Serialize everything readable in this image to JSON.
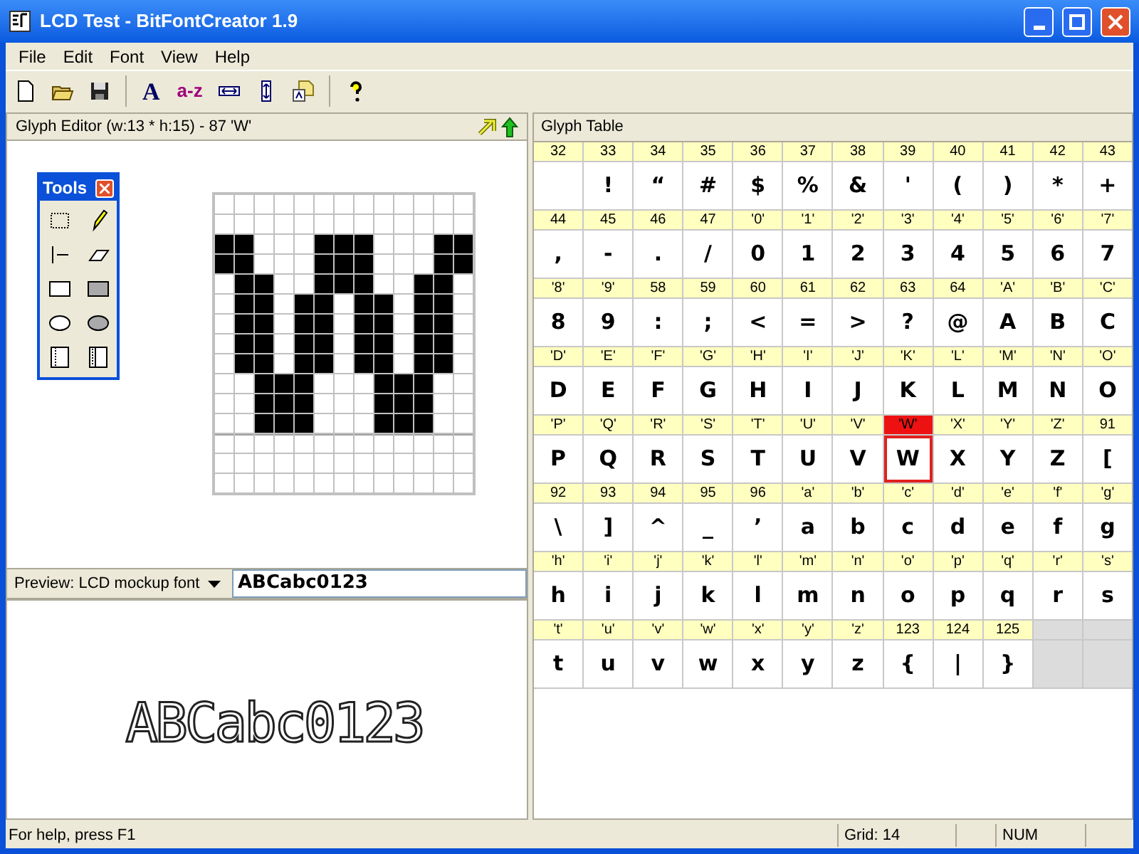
{
  "window": {
    "title": "LCD Test - BitFontCreator 1.9"
  },
  "menu": [
    "File",
    "Edit",
    "Font",
    "View",
    "Help"
  ],
  "toolbar": [
    {
      "kind": "new"
    },
    {
      "kind": "open"
    },
    {
      "kind": "save"
    },
    {
      "kind": "sep"
    },
    {
      "kind": "font",
      "label": "A"
    },
    {
      "kind": "range",
      "label": "a-z"
    },
    {
      "kind": "width"
    },
    {
      "kind": "height"
    },
    {
      "kind": "import"
    },
    {
      "kind": "sep"
    },
    {
      "kind": "help"
    }
  ],
  "glyph_editor": {
    "title": "Glyph Editor (w:13 * h:15) - 87 'W'",
    "pixels": [
      [
        false,
        false,
        false,
        false,
        false,
        false,
        false,
        false,
        false,
        false,
        false,
        false,
        false
      ],
      [
        false,
        false,
        false,
        false,
        false,
        false,
        false,
        false,
        false,
        false,
        false,
        false,
        false
      ],
      [
        true,
        true,
        false,
        false,
        false,
        true,
        true,
        true,
        false,
        false,
        false,
        true,
        true
      ],
      [
        true,
        true,
        false,
        false,
        false,
        true,
        true,
        true,
        false,
        false,
        false,
        true,
        true
      ],
      [
        false,
        true,
        true,
        false,
        false,
        true,
        true,
        true,
        false,
        false,
        true,
        true,
        false
      ],
      [
        false,
        true,
        true,
        false,
        true,
        true,
        false,
        true,
        true,
        false,
        true,
        true,
        false
      ],
      [
        false,
        true,
        true,
        false,
        true,
        true,
        false,
        true,
        true,
        false,
        true,
        true,
        false
      ],
      [
        false,
        true,
        true,
        false,
        true,
        true,
        false,
        true,
        true,
        false,
        true,
        true,
        false
      ],
      [
        false,
        true,
        true,
        false,
        true,
        true,
        false,
        true,
        true,
        false,
        true,
        true,
        false
      ],
      [
        false,
        false,
        true,
        true,
        true,
        false,
        false,
        false,
        true,
        true,
        true,
        false,
        false
      ],
      [
        false,
        false,
        true,
        true,
        true,
        false,
        false,
        false,
        true,
        true,
        true,
        false,
        false
      ],
      [
        false,
        false,
        true,
        true,
        true,
        false,
        false,
        false,
        true,
        true,
        true,
        false,
        false
      ],
      [
        false,
        false,
        false,
        false,
        false,
        false,
        false,
        false,
        false,
        false,
        false,
        false,
        false
      ],
      [
        false,
        false,
        false,
        false,
        false,
        false,
        false,
        false,
        false,
        false,
        false,
        false,
        false
      ],
      [
        false,
        false,
        false,
        false,
        false,
        false,
        false,
        false,
        false,
        false,
        false,
        false,
        false
      ]
    ]
  },
  "tools": {
    "title": "Tools",
    "items": [
      {
        "kind": "select"
      },
      {
        "kind": "pencil"
      },
      {
        "kind": "line"
      },
      {
        "kind": "eraser"
      },
      {
        "kind": "rect"
      },
      {
        "kind": "rect-fill"
      },
      {
        "kind": "ellipse"
      },
      {
        "kind": "ellipse-fill"
      },
      {
        "kind": "col-left"
      },
      {
        "kind": "col-right"
      }
    ]
  },
  "preview": {
    "font_label": "Preview: LCD mockup font",
    "text": "ABCabc0123",
    "rendered": "ABCabc0123"
  },
  "glyph_table": {
    "title": "Glyph Table",
    "cells": [
      {
        "code": "32",
        "selected": false
      },
      {
        "code": "33",
        "glyph": "!",
        "selected": false
      },
      {
        "code": "34",
        "glyph": "“",
        "selected": false
      },
      {
        "code": "35",
        "glyph": "#",
        "selected": false
      },
      {
        "code": "36",
        "glyph": "$",
        "selected": false
      },
      {
        "code": "37",
        "glyph": "%",
        "selected": false
      },
      {
        "code": "38",
        "glyph": "&",
        "selected": false
      },
      {
        "code": "39",
        "glyph": "'",
        "selected": false
      },
      {
        "code": "40",
        "glyph": "(",
        "selected": false
      },
      {
        "code": "41",
        "glyph": ")",
        "selected": false
      },
      {
        "code": "42",
        "glyph": "*",
        "selected": false
      },
      {
        "code": "43",
        "glyph": "+",
        "selected": false
      },
      {
        "code": "44",
        "glyph": ",",
        "selected": false
      },
      {
        "code": "45",
        "glyph": "-",
        "selected": false
      },
      {
        "code": "46",
        "glyph": ".",
        "selected": false
      },
      {
        "code": "47",
        "glyph": "/",
        "selected": false
      },
      {
        "code": "'0'",
        "glyph": "0",
        "selected": false
      },
      {
        "code": "'1'",
        "glyph": "1",
        "selected": false
      },
      {
        "code": "'2'",
        "glyph": "2",
        "selected": false
      },
      {
        "code": "'3'",
        "glyph": "3",
        "selected": false
      },
      {
        "code": "'4'",
        "glyph": "4",
        "selected": false
      },
      {
        "code": "'5'",
        "glyph": "5",
        "selected": false
      },
      {
        "code": "'6'",
        "glyph": "6",
        "selected": false
      },
      {
        "code": "'7'",
        "glyph": "7",
        "selected": false
      },
      {
        "code": "'8'",
        "glyph": "8",
        "selected": false
      },
      {
        "code": "'9'",
        "glyph": "9",
        "selected": false
      },
      {
        "code": "58",
        "glyph": ":",
        "selected": false
      },
      {
        "code": "59",
        "glyph": ";",
        "selected": false
      },
      {
        "code": "60",
        "glyph": "<",
        "selected": false
      },
      {
        "code": "61",
        "glyph": "=",
        "selected": false
      },
      {
        "code": "62",
        "glyph": ">",
        "selected": false
      },
      {
        "code": "63",
        "glyph": "?",
        "selected": false
      },
      {
        "code": "64",
        "glyph": "@",
        "selected": false
      },
      {
        "code": "'A'",
        "glyph": "A",
        "selected": false
      },
      {
        "code": "'B'",
        "glyph": "B",
        "selected": false
      },
      {
        "code": "'C'",
        "glyph": "C",
        "selected": false
      },
      {
        "code": "'D'",
        "glyph": "D",
        "selected": false
      },
      {
        "code": "'E'",
        "glyph": "E",
        "selected": false
      },
      {
        "code": "'F'",
        "glyph": "F",
        "selected": false
      },
      {
        "code": "'G'",
        "glyph": "G",
        "selected": false
      },
      {
        "code": "'H'",
        "glyph": "H",
        "selected": false
      },
      {
        "code": "'I'",
        "glyph": "I",
        "selected": false
      },
      {
        "code": "'J'",
        "glyph": "J",
        "selected": false
      },
      {
        "code": "'K'",
        "glyph": "K",
        "selected": false
      },
      {
        "code": "'L'",
        "glyph": "L",
        "selected": false
      },
      {
        "code": "'M'",
        "glyph": "M",
        "selected": false
      },
      {
        "code": "'N'",
        "glyph": "N",
        "selected": false
      },
      {
        "code": "'O'",
        "glyph": "O",
        "selected": false
      },
      {
        "code": "'P'",
        "glyph": "P",
        "selected": false
      },
      {
        "code": "'Q'",
        "glyph": "Q",
        "selected": false
      },
      {
        "code": "'R'",
        "glyph": "R",
        "selected": false
      },
      {
        "code": "'S'",
        "glyph": "S",
        "selected": false
      },
      {
        "code": "'T'",
        "glyph": "T",
        "selected": false
      },
      {
        "code": "'U'",
        "glyph": "U",
        "selected": false
      },
      {
        "code": "'V'",
        "glyph": "V",
        "selected": false
      },
      {
        "code": "'W'",
        "glyph": "W",
        "selected": true
      },
      {
        "code": "'X'",
        "glyph": "X",
        "selected": false
      },
      {
        "code": "'Y'",
        "glyph": "Y",
        "selected": false
      },
      {
        "code": "'Z'",
        "glyph": "Z",
        "selected": false
      },
      {
        "code": "91",
        "glyph": "[",
        "selected": false
      },
      {
        "code": "92",
        "glyph": "\\",
        "selected": false
      },
      {
        "code": "93",
        "glyph": "]",
        "selected": false
      },
      {
        "code": "94",
        "glyph": "^",
        "selected": false
      },
      {
        "code": "95",
        "glyph": "_",
        "selected": false
      },
      {
        "code": "96",
        "glyph": "’",
        "selected": false
      },
      {
        "code": "'a'",
        "glyph": "a",
        "selected": false
      },
      {
        "code": "'b'",
        "glyph": "b",
        "selected": false
      },
      {
        "code": "'c'",
        "glyph": "c",
        "selected": false
      },
      {
        "code": "'d'",
        "glyph": "d",
        "selected": false
      },
      {
        "code": "'e'",
        "glyph": "e",
        "selected": false
      },
      {
        "code": "'f'",
        "glyph": "f",
        "selected": false
      },
      {
        "code": "'g'",
        "glyph": "g",
        "selected": false
      },
      {
        "code": "'h'",
        "glyph": "h",
        "selected": false
      },
      {
        "code": "'i'",
        "glyph": "i",
        "selected": false
      },
      {
        "code": "'j'",
        "glyph": "j",
        "selected": false
      },
      {
        "code": "'k'",
        "glyph": "k",
        "selected": false
      },
      {
        "code": "'l'",
        "glyph": "l",
        "selected": false
      },
      {
        "code": "'m'",
        "glyph": "m",
        "selected": false
      },
      {
        "code": "'n'",
        "glyph": "n",
        "selected": false
      },
      {
        "code": "'o'",
        "glyph": "o",
        "selected": false
      },
      {
        "code": "'p'",
        "glyph": "p",
        "selected": false
      },
      {
        "code": "'q'",
        "glyph": "q",
        "selected": false
      },
      {
        "code": "'r'",
        "glyph": "r",
        "selected": false
      },
      {
        "code": "'s'",
        "glyph": "s",
        "selected": false
      },
      {
        "code": "'t'",
        "glyph": "t",
        "selected": false
      },
      {
        "code": "'u'",
        "glyph": "u",
        "selected": false
      },
      {
        "code": "'v'",
        "glyph": "v",
        "selected": false
      },
      {
        "code": "'w'",
        "glyph": "w",
        "selected": false
      },
      {
        "code": "'x'",
        "glyph": "x",
        "selected": false
      },
      {
        "code": "'y'",
        "glyph": "y",
        "selected": false
      },
      {
        "code": "'z'",
        "glyph": "z",
        "selected": false
      },
      {
        "code": "123",
        "glyph": "{",
        "selected": false
      },
      {
        "code": "124",
        "glyph": "|",
        "selected": false
      },
      {
        "code": "125",
        "glyph": "}",
        "selected": false
      }
    ]
  },
  "status_bar": {
    "help": "For help, press F1",
    "grid": "Grid: 14",
    "num": "NUM"
  }
}
